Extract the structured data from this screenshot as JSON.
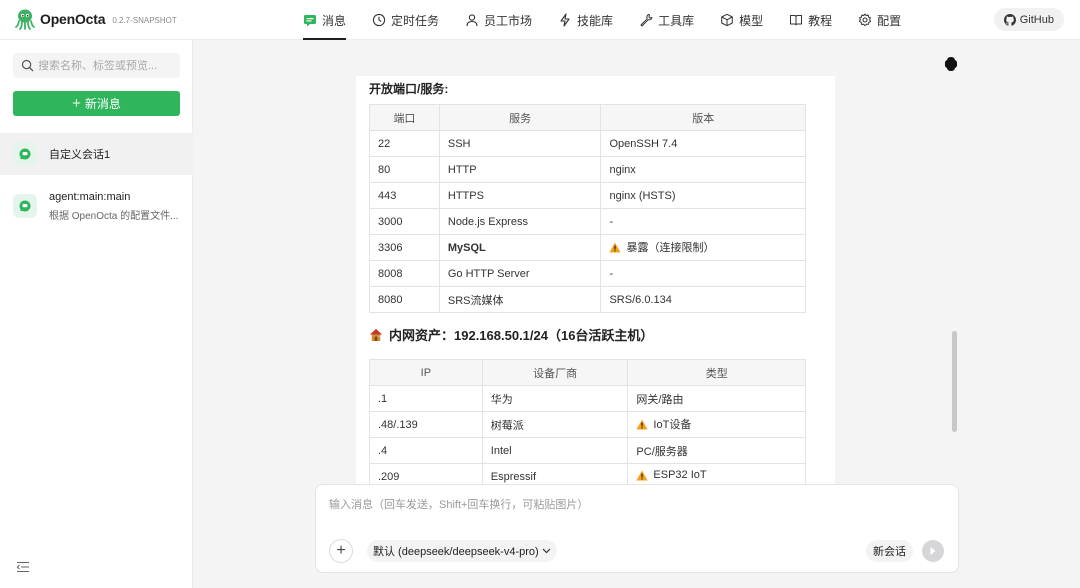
{
  "app": {
    "name": "OpenOcta",
    "version": "0.2.7-SNAPSHOT"
  },
  "nav": {
    "items": [
      {
        "label": "消息",
        "icon": "chat-icon",
        "active": true
      },
      {
        "label": "定时任务",
        "icon": "clock-icon"
      },
      {
        "label": "员工市场",
        "icon": "user-icon"
      },
      {
        "label": "技能库",
        "icon": "bolt-icon"
      },
      {
        "label": "工具库",
        "icon": "wrench-icon"
      },
      {
        "label": "模型",
        "icon": "cube-icon"
      },
      {
        "label": "教程",
        "icon": "book-icon"
      },
      {
        "label": "配置",
        "icon": "gear-icon"
      }
    ],
    "github_label": "GitHub"
  },
  "sidebar": {
    "search_placeholder": "搜索名称、标签或预览...",
    "new_button_label": "新消息",
    "conversations": [
      {
        "title": "自定义会话1",
        "subtitle": "",
        "active": true
      },
      {
        "title": "agent:main:main",
        "subtitle": "根据 OpenOcta 的配置文件..."
      }
    ]
  },
  "content": {
    "ports_title": "开放端口/服务:",
    "ports_table": {
      "headers": [
        "端口",
        "服务",
        "版本"
      ],
      "rows": [
        {
          "port": "22",
          "service": "SSH",
          "version": "OpenSSH 7.4"
        },
        {
          "port": "80",
          "service": "HTTP",
          "version": "nginx"
        },
        {
          "port": "443",
          "service": "HTTPS",
          "version": "nginx (HSTS)"
        },
        {
          "port": "3000",
          "service": "Node.js Express",
          "version": "-"
        },
        {
          "port": "3306",
          "service": "MySQL",
          "version": "暴露（连接限制）"
        },
        {
          "port": "8008",
          "service": "Go HTTP Server",
          "version": "-"
        },
        {
          "port": "8080",
          "service": "SRS流媒体",
          "version": "SRS/6.0.134"
        }
      ]
    },
    "lan_title": "内网资产：192.168.50.1/24（16台活跃主机）",
    "lan_table": {
      "headers": [
        "IP",
        "设备厂商",
        "类型"
      ],
      "rows": [
        {
          "ip": ".1",
          "vendor": "华为",
          "type": "网关/路由"
        },
        {
          "ip": ".48/.139",
          "vendor": "树莓派",
          "type": "IoT设备"
        },
        {
          "ip": ".4",
          "vendor": "Intel",
          "type": "PC/服务器"
        },
        {
          "ip": ".209",
          "vendor": "Espressif",
          "type": "ESP32 IoT"
        }
      ]
    }
  },
  "composer": {
    "placeholder": "输入消息（回车发送，Shift+回车换行，可粘贴图片）",
    "model_label": "默认 (deepseek/deepseek-v4-pro)",
    "new_chat_label": "新会话"
  },
  "colors": {
    "accent": "#2fb55b",
    "warning": "#f4a21d"
  }
}
